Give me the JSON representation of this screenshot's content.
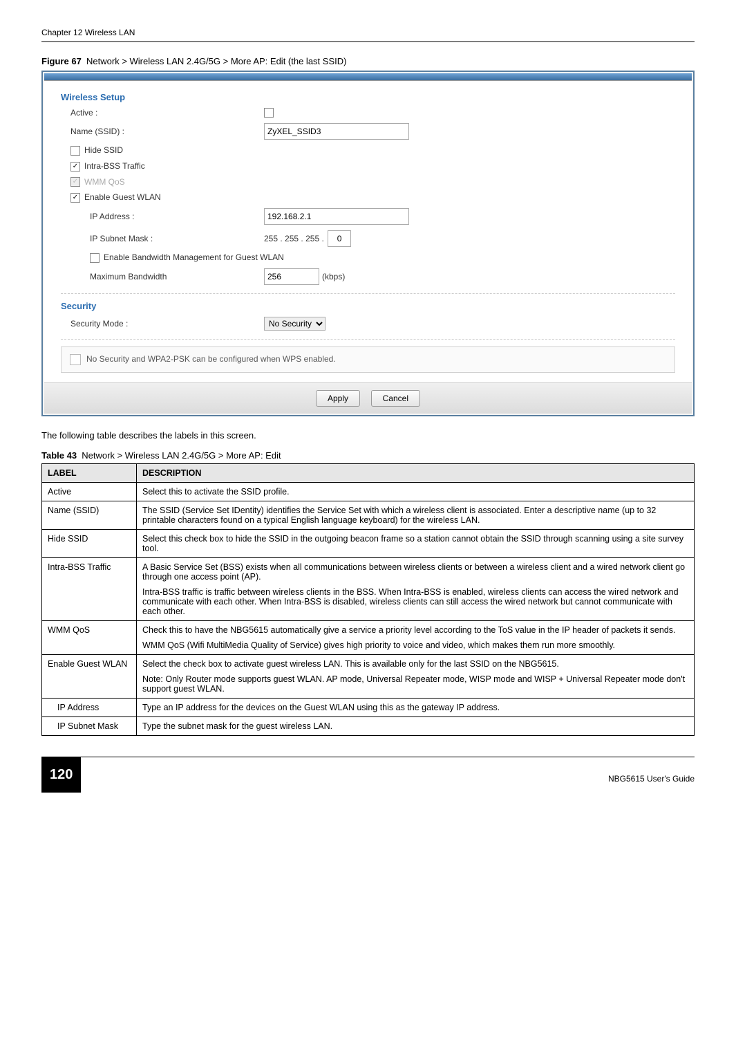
{
  "page": {
    "chapter_header": "Chapter 12 Wireless LAN",
    "page_number": "120",
    "guide": "NBG5615 User's Guide"
  },
  "figure": {
    "label": "Figure 67",
    "caption": "Network > Wireless LAN 2.4G/5G > More AP: Edit (the last SSID)"
  },
  "screenshot": {
    "section_wireless": "Wireless Setup",
    "active_label": "Active :",
    "name_label": "Name (SSID) :",
    "name_value": "ZyXEL_SSID3",
    "hide_ssid": "Hide SSID",
    "intra_bss": "Intra-BSS Traffic",
    "wmm": "WMM QoS",
    "enable_guest": "Enable Guest WLAN",
    "ip_addr_label": "IP Address :",
    "ip_addr_value": "192.168.2.1",
    "subnet_label": "IP Subnet Mask :",
    "subnet_o1": "255",
    "subnet_o2": "255",
    "subnet_o3": "255",
    "subnet_o4": "0",
    "bw_mgmt": "Enable Bandwidth Management for Guest WLAN",
    "max_bw_label": "Maximum Bandwidth",
    "max_bw_value": "256",
    "max_bw_unit": "(kbps)",
    "section_security": "Security",
    "sec_mode_label": "Security Mode :",
    "sec_mode_value": "No Security",
    "note": "No Security and WPA2-PSK can be configured when WPS enabled.",
    "btn_apply": "Apply",
    "btn_cancel": "Cancel"
  },
  "body_text": "The following table describes the labels in this screen.",
  "table": {
    "label": "Table 43",
    "caption": "Network > Wireless LAN 2.4G/5G > More AP: Edit",
    "head_label": "LABEL",
    "head_desc": "DESCRIPTION",
    "rows": [
      {
        "label": "Active",
        "desc": "Select this to activate the SSID profile."
      },
      {
        "label": "Name (SSID)",
        "desc": "The SSID (Service Set IDentity) identifies the Service Set with which a wireless client is associated. Enter a descriptive name (up to 32 printable characters found on a typical English language keyboard) for the wireless LAN."
      },
      {
        "label": "Hide SSID",
        "desc": "Select this check box to hide the SSID in the outgoing beacon frame so a station cannot obtain the SSID through scanning using a site survey tool."
      },
      {
        "label": "Intra-BSS Traffic",
        "desc1": "A Basic Service Set (BSS) exists when all communications between wireless clients or between a wireless client and a wired network client go through one access point (AP).",
        "desc2": "Intra-BSS traffic is traffic between wireless clients in the BSS. When Intra-BSS is enabled, wireless clients can access the wired network and communicate with each other. When Intra-BSS is disabled, wireless clients can still access the wired network but cannot communicate with each other."
      },
      {
        "label": "WMM QoS",
        "desc1": "Check this to have the NBG5615 automatically give a service a priority level according to the ToS value in the IP header of packets it sends.",
        "desc2": "WMM QoS (Wifi MultiMedia Quality of Service) gives high priority to voice and video, which makes them run more smoothly."
      },
      {
        "label": "Enable Guest WLAN",
        "desc1": "Select the check box to activate guest wireless LAN. This is available only for the last SSID on the NBG5615.",
        "desc2": "Note: Only Router mode supports guest WLAN. AP mode, Universal Repeater mode, WISP mode and WISP + Universal Repeater mode don't support guest WLAN."
      },
      {
        "label": "IP Address",
        "indent": true,
        "desc": "Type an IP address for the devices on the Guest WLAN using this as the gateway IP address."
      },
      {
        "label": "IP Subnet Mask",
        "indent": true,
        "desc": "Type the subnet mask for the guest wireless LAN."
      }
    ]
  }
}
